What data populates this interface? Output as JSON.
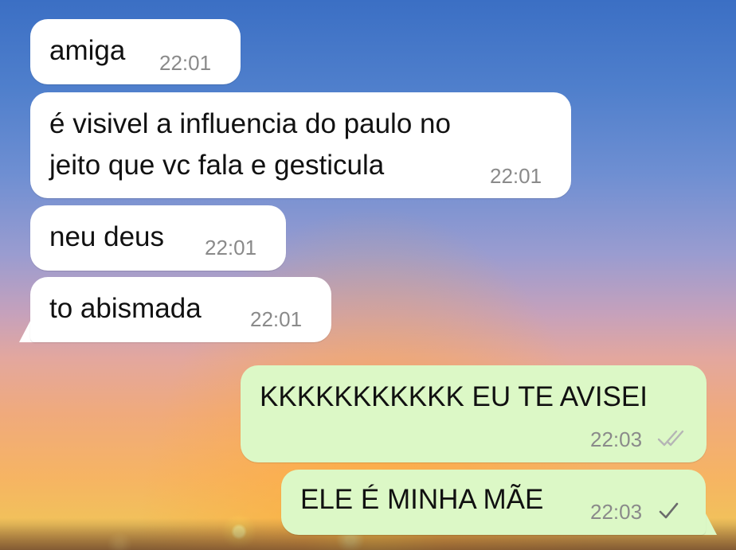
{
  "messages": [
    {
      "direction": "incoming",
      "text": "amiga",
      "time": "22:01"
    },
    {
      "direction": "incoming",
      "lines": [
        "é visivel a influencia do paulo no",
        "jeito que vc fala e gesticula"
      ],
      "time": "22:01"
    },
    {
      "direction": "incoming",
      "text": "neu deus",
      "time": "22:01"
    },
    {
      "direction": "incoming",
      "text": "to abismada",
      "time": "22:01"
    },
    {
      "direction": "outgoing",
      "text": "KKKKKKKKKKK EU TE AVISEI",
      "time": "22:03",
      "status": "delivered",
      "status_icon": "double-check-icon"
    },
    {
      "direction": "outgoing",
      "text": "ELE É MINHA MÃE",
      "time": "22:03",
      "status": "sent",
      "status_icon": "single-check-icon"
    }
  ],
  "colors": {
    "incoming_bubble": "#ffffff",
    "outgoing_bubble": "#dcf8c6",
    "timestamp": "#8a8a8a",
    "double_check": "#b5b5b5",
    "single_check": "#6b6b6b"
  }
}
